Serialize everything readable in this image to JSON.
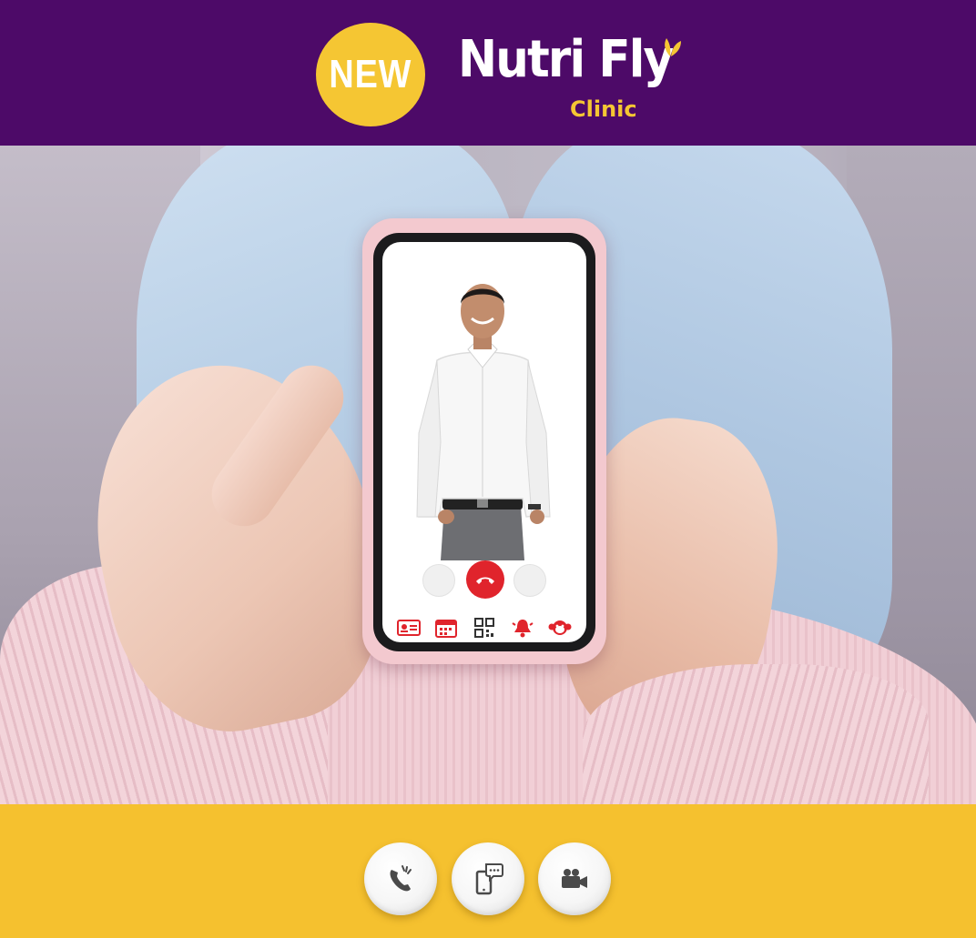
{
  "header": {
    "badge_text": "NEW",
    "brand_name": "Nutri Fly",
    "brand_sub": "Clinic"
  },
  "colors": {
    "header_bg": "#4d0a68",
    "accent_yellow": "#f5c633",
    "end_call_red": "#e0242c"
  },
  "phone_screen": {
    "app_bar_icons": [
      "id-card-icon",
      "calendar-icon",
      "qr-code-icon",
      "bell-icon",
      "monkey-icon"
    ]
  },
  "footer": {
    "buttons": [
      "phone-call-icon",
      "mobile-chat-icon",
      "video-camera-icon"
    ]
  }
}
